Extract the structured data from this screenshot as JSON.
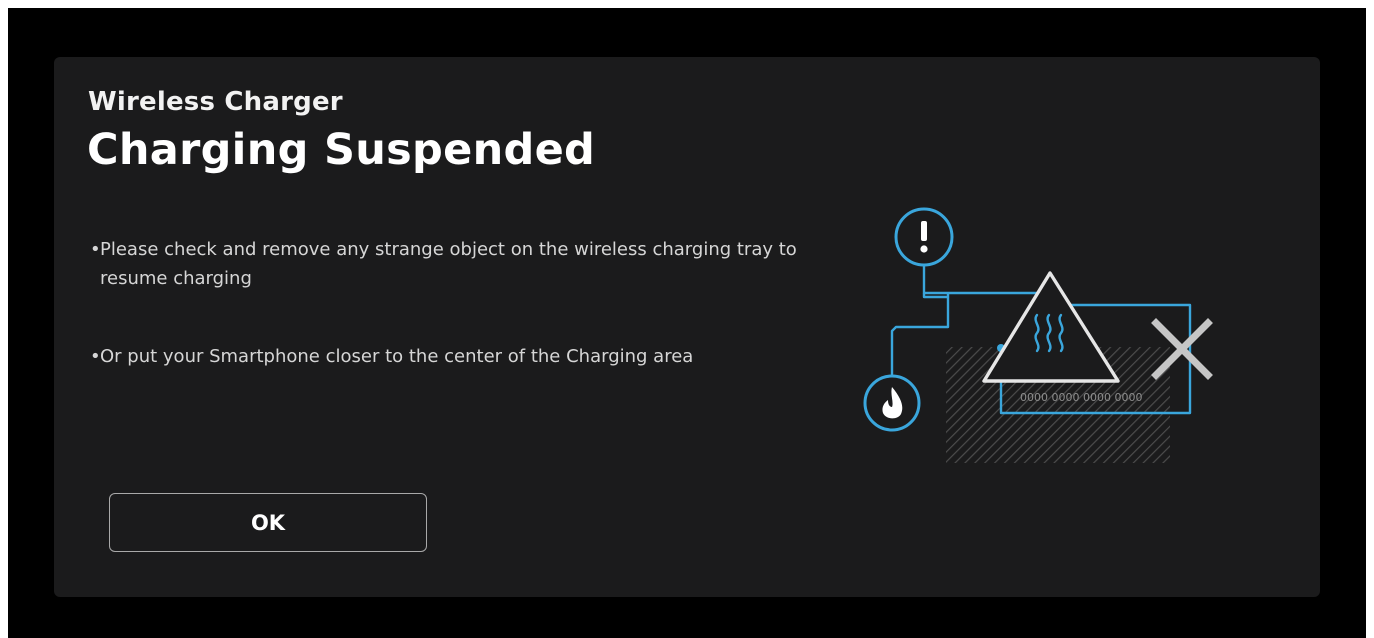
{
  "dialog": {
    "subtitle": "Wireless Charger",
    "title": "Charging Suspended",
    "messages": [
      "Please check and remove any strange object on the wireless charging tray to resume charging",
      "Or put your Smartphone closer to the center of the Charging area"
    ],
    "bullet": "•",
    "ok_label": "OK"
  },
  "illustration": {
    "card_number": "0000 0000 0000 0000",
    "icons": [
      "exclamation-icon",
      "heat-warning-icon",
      "close-icon",
      "fire-icon",
      "card-icon",
      "nfc-icon"
    ]
  },
  "colors": {
    "background": "#000000",
    "dialog": "#1b1b1c",
    "accent": "#3aa6dc",
    "text": "#ffffff"
  }
}
